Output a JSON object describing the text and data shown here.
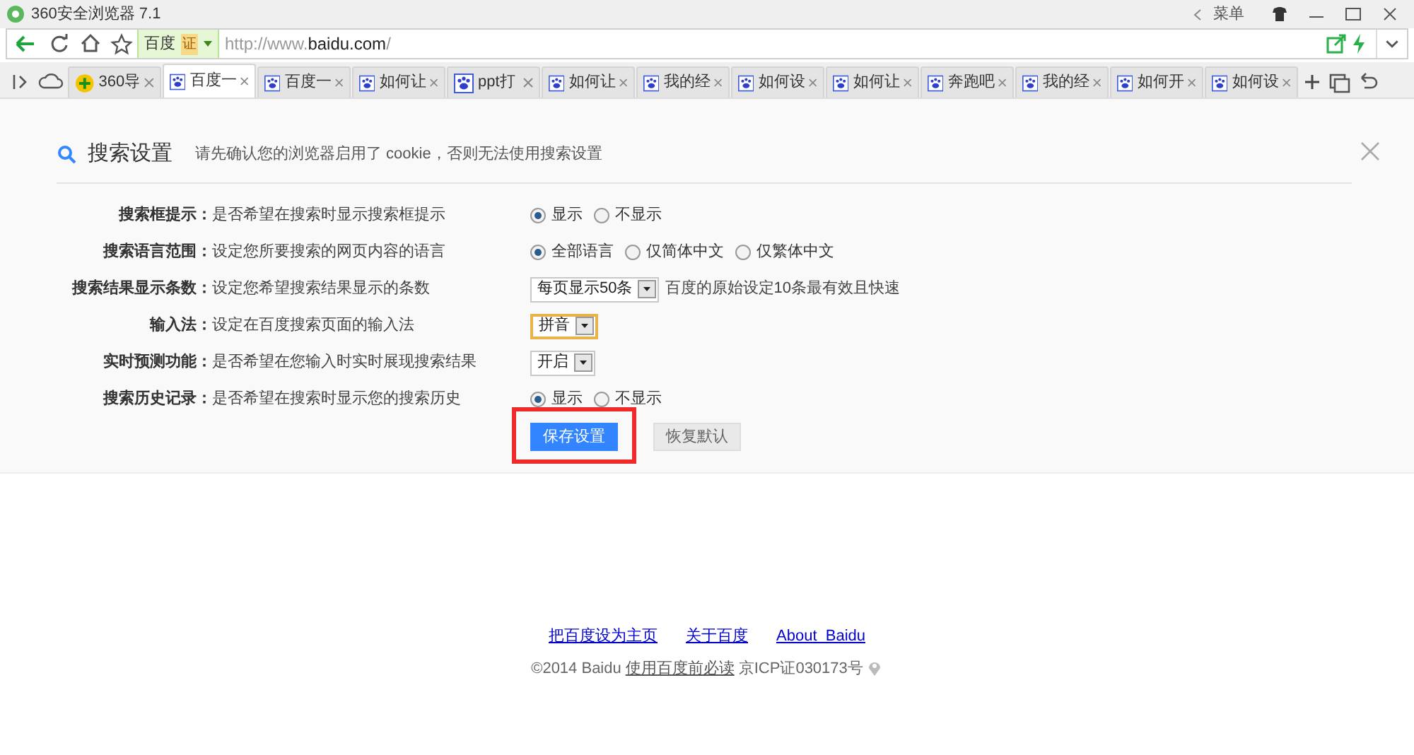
{
  "window": {
    "title": "360安全浏览器 7.1",
    "menu": "菜单"
  },
  "address_bar": {
    "site_label": "百度",
    "cert_badge": "证",
    "url_prefix": "http://www.",
    "url_domain": "baidu.com",
    "url_suffix": "/"
  },
  "tabs": [
    {
      "label": "360导",
      "kind": "portal",
      "selected": false
    },
    {
      "label": "百度一",
      "kind": "baidu",
      "selected": true
    },
    {
      "label": "百度一",
      "kind": "baidu",
      "selected": false
    },
    {
      "label": "如何让",
      "kind": "baidu",
      "selected": false
    },
    {
      "label": "ppt打",
      "kind": "baidu",
      "selected": false
    },
    {
      "label": "如何让",
      "kind": "baidu",
      "selected": false
    },
    {
      "label": "我的经",
      "kind": "baidu",
      "selected": false
    },
    {
      "label": "如何设",
      "kind": "baidu",
      "selected": false
    },
    {
      "label": "如何让",
      "kind": "baidu",
      "selected": false
    },
    {
      "label": "奔跑吧",
      "kind": "baidu",
      "selected": false
    },
    {
      "label": "我的经",
      "kind": "baidu",
      "selected": false
    },
    {
      "label": "如何开",
      "kind": "baidu",
      "selected": false
    },
    {
      "label": "如何设",
      "kind": "baidu",
      "selected": false
    }
  ],
  "settings": {
    "title": "搜索设置",
    "notice": "请先确认您的浏览器启用了 cookie，否则无法使用搜索设置",
    "rows": [
      {
        "label": "搜索框提示：",
        "description": "是否希望在搜索时显示搜索框提示",
        "kind": "radio",
        "options": [
          {
            "label": "显示",
            "selected": true
          },
          {
            "label": "不显示",
            "selected": false
          }
        ]
      },
      {
        "label": "搜索语言范围：",
        "description": "设定您所要搜索的网页内容的语言",
        "kind": "radio",
        "options": [
          {
            "label": "全部语言",
            "selected": true
          },
          {
            "label": "仅简体中文",
            "selected": false
          },
          {
            "label": "仅繁体中文",
            "selected": false
          }
        ]
      },
      {
        "label": "搜索结果显示条数：",
        "description": "设定您希望搜索结果显示的条数",
        "kind": "select",
        "value": "每页显示50条",
        "focused": false,
        "note": "百度的原始设定10条最有效且快速"
      },
      {
        "label": "输入法：",
        "description": "设定在百度搜索页面的输入法",
        "kind": "select",
        "value": "拼音",
        "focused": true
      },
      {
        "label": "实时预测功能：",
        "description": "是否希望在您输入时实时展现搜索结果",
        "kind": "select",
        "value": "开启",
        "focused": false
      },
      {
        "label": "搜索历史记录：",
        "description": "是否希望在搜索时显示您的搜索历史",
        "kind": "radio",
        "options": [
          {
            "label": "显示",
            "selected": true
          },
          {
            "label": "不显示",
            "selected": false
          }
        ]
      }
    ],
    "buttons": [
      {
        "label": "保存设置",
        "kind": "primary",
        "highlighted": true
      },
      {
        "label": "恢复默认",
        "kind": "secondary",
        "highlighted": false
      }
    ]
  },
  "footer": {
    "links": [
      "把百度设为主页",
      "关于百度",
      "About  Baidu"
    ],
    "copyright": "©2014 Baidu",
    "terms_link": "使用百度前必读",
    "icp": "京ICP证030173号"
  }
}
